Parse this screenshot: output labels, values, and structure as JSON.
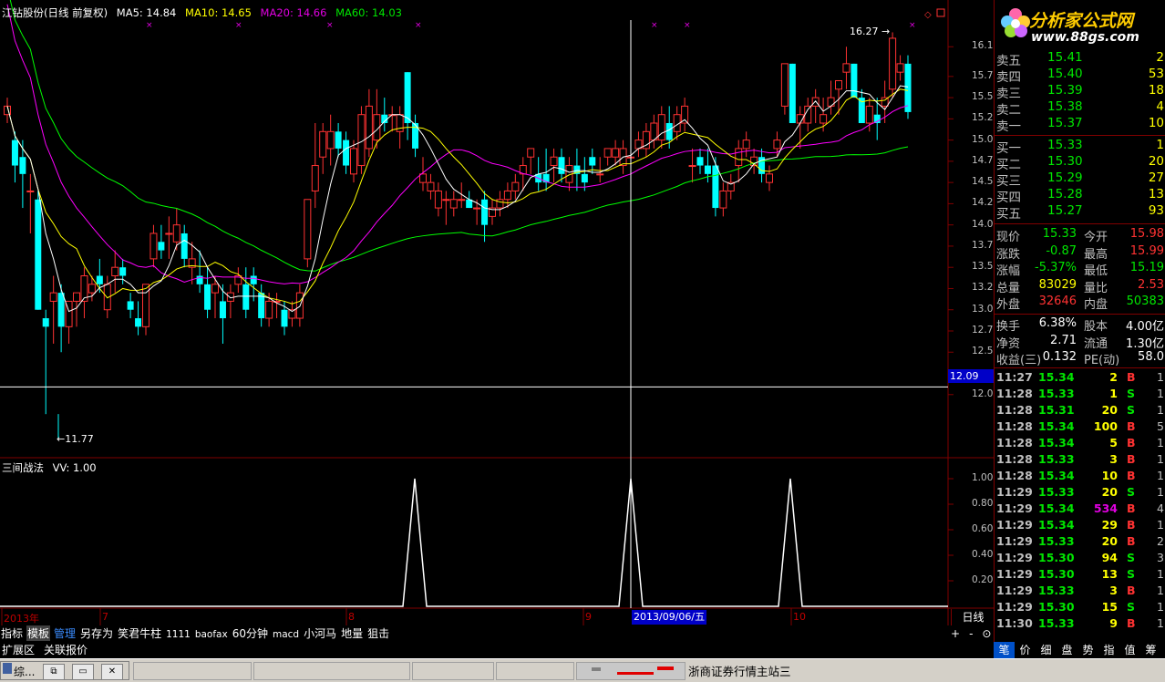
{
  "title": {
    "stock": "江钻股份(日线 前复权)",
    "ma5": "MA5: 14.84",
    "ma10": "MA10: 14.65",
    "ma20": "MA20: 14.66",
    "ma60": "MA60: 14.03"
  },
  "colors": {
    "ma5": "#ffffff",
    "ma10": "#ffff00",
    "ma20": "#ff00ff",
    "ma60": "#00ff00",
    "up": "#ff3232",
    "down": "#00ffff",
    "grid": "#800000"
  },
  "chart_data": {
    "type": "candlestick",
    "ylim": [
      11.6,
      16.35
    ],
    "yticks": [
      "16.1",
      "15.75",
      "15.50",
      "15.25",
      "15.00",
      "14.75",
      "14.50",
      "14.25",
      "14.00",
      "13.75",
      "13.50",
      "13.25",
      "13.00",
      "12.75",
      "12.50",
      "12.00"
    ],
    "high_annotation": "16.27",
    "low_annotation": "11.77",
    "crosshair_price": "12.09",
    "crosshair_date": "2013/09/06/五",
    "x_labels": [
      "2013年",
      "7",
      "8",
      "9",
      "10"
    ],
    "candles": [
      [
        15.3,
        15.5,
        15.2,
        15.4
      ],
      [
        15.0,
        15.1,
        14.5,
        14.7
      ],
      [
        14.8,
        15.0,
        14.2,
        14.6
      ],
      [
        14.4,
        14.6,
        13.9,
        14.4
      ],
      [
        14.3,
        14.4,
        13.0,
        13.0
      ],
      [
        12.9,
        13.0,
        11.77,
        12.8
      ],
      [
        13.1,
        13.4,
        12.6,
        13.2
      ],
      [
        13.2,
        13.3,
        12.5,
        12.8
      ],
      [
        12.8,
        13.1,
        12.6,
        13.1
      ],
      [
        13.1,
        13.2,
        12.8,
        13.2
      ],
      [
        13.1,
        13.5,
        12.9,
        13.4
      ],
      [
        13.2,
        13.4,
        13.1,
        13.3
      ],
      [
        13.4,
        13.6,
        13.2,
        13.3
      ],
      [
        13.0,
        13.4,
        12.9,
        13.3
      ],
      [
        13.4,
        13.7,
        13.2,
        13.5
      ],
      [
        13.5,
        13.6,
        13.3,
        13.4
      ],
      [
        13.1,
        13.2,
        12.9,
        13.0
      ],
      [
        12.9,
        13.1,
        12.7,
        12.8
      ],
      [
        12.8,
        13.3,
        12.7,
        13.3
      ],
      [
        13.6,
        14.0,
        13.5,
        13.9
      ],
      [
        13.8,
        14.0,
        13.6,
        13.7
      ],
      [
        13.9,
        14.1,
        13.6,
        13.9
      ],
      [
        13.8,
        14.2,
        13.7,
        14.0
      ],
      [
        13.9,
        14.0,
        13.5,
        13.6
      ],
      [
        13.5,
        13.8,
        13.3,
        13.6
      ],
      [
        13.4,
        13.7,
        13.2,
        13.3
      ],
      [
        13.3,
        13.5,
        12.9,
        13.0
      ],
      [
        13.2,
        13.4,
        12.9,
        13.3
      ],
      [
        13.1,
        13.3,
        12.6,
        12.9
      ],
      [
        13.1,
        13.3,
        12.9,
        13.2
      ],
      [
        13.3,
        13.5,
        13.2,
        13.4
      ],
      [
        13.3,
        13.5,
        12.9,
        13.0
      ],
      [
        13.4,
        13.5,
        13.1,
        13.3
      ],
      [
        13.2,
        13.3,
        12.8,
        12.9
      ],
      [
        12.9,
        13.2,
        12.8,
        13.1
      ],
      [
        13.1,
        13.2,
        12.9,
        13.1
      ],
      [
        13.0,
        13.1,
        12.7,
        12.8
      ],
      [
        12.9,
        13.1,
        12.8,
        13.0
      ],
      [
        12.9,
        13.3,
        12.8,
        13.2
      ],
      [
        13.6,
        14.3,
        13.5,
        14.3
      ],
      [
        14.4,
        15.2,
        14.2,
        14.7
      ],
      [
        14.8,
        15.2,
        14.6,
        15.1
      ],
      [
        14.9,
        15.3,
        14.7,
        15.1
      ],
      [
        15.1,
        15.2,
        14.8,
        14.9
      ],
      [
        15.0,
        15.1,
        14.6,
        14.7
      ],
      [
        14.6,
        15.0,
        14.5,
        14.9
      ],
      [
        14.7,
        15.4,
        14.6,
        15.3
      ],
      [
        14.9,
        15.6,
        14.8,
        15.4
      ],
      [
        15.0,
        15.6,
        14.9,
        15.3
      ],
      [
        15.3,
        15.5,
        15.1,
        15.2
      ],
      [
        15.3,
        15.4,
        15.1,
        15.3
      ],
      [
        15.1,
        15.4,
        14.9,
        15.3
      ],
      [
        15.8,
        15.8,
        15.0,
        15.2
      ],
      [
        15.2,
        15.3,
        14.8,
        14.9
      ],
      [
        14.5,
        14.8,
        14.4,
        14.6
      ],
      [
        14.4,
        14.6,
        14.3,
        14.5
      ],
      [
        14.2,
        14.5,
        14.1,
        14.4
      ],
      [
        14.3,
        14.4,
        14.0,
        14.3
      ],
      [
        14.2,
        14.4,
        14.1,
        14.3
      ],
      [
        14.3,
        14.5,
        14.2,
        14.3
      ],
      [
        14.3,
        14.4,
        14.2,
        14.2
      ],
      [
        14.2,
        14.3,
        14.0,
        14.2
      ],
      [
        14.3,
        14.4,
        13.8,
        14.0
      ],
      [
        14.1,
        14.3,
        14.0,
        14.2
      ],
      [
        14.2,
        14.4,
        14.1,
        14.3
      ],
      [
        14.3,
        14.5,
        14.2,
        14.4
      ],
      [
        14.4,
        14.6,
        14.3,
        14.5
      ],
      [
        14.6,
        14.8,
        14.4,
        14.7
      ],
      [
        14.8,
        14.9,
        14.6,
        14.9
      ],
      [
        14.6,
        14.8,
        14.4,
        14.5
      ],
      [
        14.6,
        14.9,
        14.4,
        14.5
      ],
      [
        14.7,
        14.9,
        14.5,
        14.8
      ],
      [
        14.8,
        14.9,
        14.5,
        14.6
      ],
      [
        14.5,
        14.8,
        14.4,
        14.7
      ],
      [
        14.7,
        14.9,
        14.4,
        14.6
      ],
      [
        14.6,
        14.8,
        14.4,
        14.5
      ],
      [
        14.8,
        14.9,
        14.6,
        14.7
      ],
      [
        14.6,
        14.8,
        14.5,
        14.6
      ],
      [
        14.8,
        14.9,
        14.7,
        14.9
      ],
      [
        14.8,
        15.0,
        14.7,
        14.9
      ],
      [
        14.7,
        15.0,
        14.6,
        14.9
      ],
      [
        14.8,
        15.0,
        14.7,
        14.8
      ],
      [
        14.9,
        15.1,
        14.8,
        15.0
      ],
      [
        14.9,
        15.2,
        14.8,
        15.1
      ],
      [
        15.0,
        15.3,
        14.9,
        15.2
      ],
      [
        15.0,
        15.4,
        14.9,
        15.3
      ],
      [
        15.2,
        15.4,
        14.9,
        15.0
      ],
      [
        15.1,
        15.4,
        15.0,
        15.3
      ],
      [
        15.2,
        15.5,
        15.1,
        15.4
      ],
      [
        14.7,
        14.9,
        14.5,
        14.7
      ],
      [
        14.8,
        14.9,
        14.6,
        14.7
      ],
      [
        14.7,
        14.9,
        14.5,
        14.6
      ],
      [
        14.7,
        14.8,
        14.1,
        14.2
      ],
      [
        14.2,
        14.5,
        14.1,
        14.4
      ],
      [
        14.4,
        14.6,
        14.3,
        14.5
      ],
      [
        14.7,
        15.0,
        14.5,
        14.9
      ],
      [
        14.9,
        15.1,
        14.8,
        15.0
      ],
      [
        14.7,
        14.9,
        14.6,
        14.8
      ],
      [
        14.8,
        14.9,
        14.5,
        14.6
      ],
      [
        14.5,
        14.7,
        14.4,
        14.6
      ],
      [
        14.9,
        15.1,
        14.8,
        15.0
      ],
      [
        15.4,
        15.9,
        15.3,
        15.9
      ],
      [
        15.9,
        15.9,
        15.2,
        15.2
      ],
      [
        15.2,
        15.4,
        14.9,
        15.3
      ],
      [
        15.2,
        15.5,
        15.1,
        15.4
      ],
      [
        15.4,
        15.6,
        15.2,
        15.5
      ],
      [
        15.2,
        15.5,
        15.1,
        15.3
      ],
      [
        15.4,
        15.7,
        15.3,
        15.5
      ],
      [
        15.6,
        15.7,
        15.3,
        15.7
      ],
      [
        15.8,
        16.1,
        15.6,
        15.9
      ],
      [
        15.9,
        15.9,
        15.5,
        15.5
      ],
      [
        15.5,
        15.6,
        15.2,
        15.2
      ],
      [
        15.2,
        15.5,
        15.1,
        15.4
      ],
      [
        15.3,
        15.5,
        15.0,
        15.2
      ],
      [
        15.4,
        15.7,
        15.2,
        15.5
      ],
      [
        15.6,
        16.27,
        15.5,
        16.2
      ],
      [
        15.8,
        16.0,
        15.7,
        15.9
      ],
      [
        15.9,
        16.0,
        15.25,
        15.33
      ]
    ]
  },
  "indicator": {
    "title": "三间战法",
    "value": "VV: 1.00",
    "yticks": [
      "1.00",
      "0.80",
      "0.60",
      "0.40",
      "0.20"
    ]
  },
  "toolbar": {
    "items": [
      "指标",
      "模板",
      "管理",
      "另存为",
      "笑君牛柱",
      "1111",
      "baofax",
      "60分钟",
      "macd",
      "小河马",
      "地量",
      "狙击"
    ],
    "row2": [
      "扩展区",
      "关联报价"
    ],
    "period": "日线",
    "zoom": [
      "+",
      "-",
      "⊙"
    ]
  },
  "panel": {
    "logo_name": "分析家公式网",
    "logo_url": "www.88gs.com",
    "sell": [
      {
        "label": "卖五",
        "price": "15.41",
        "vol": "2"
      },
      {
        "label": "卖四",
        "price": "15.40",
        "vol": "53"
      },
      {
        "label": "卖三",
        "price": "15.39",
        "vol": "18"
      },
      {
        "label": "卖二",
        "price": "15.38",
        "vol": "4"
      },
      {
        "label": "卖一",
        "price": "15.37",
        "vol": "10"
      }
    ],
    "buy": [
      {
        "label": "买一",
        "price": "15.33",
        "vol": "1"
      },
      {
        "label": "买二",
        "price": "15.30",
        "vol": "20"
      },
      {
        "label": "买三",
        "price": "15.29",
        "vol": "27"
      },
      {
        "label": "买四",
        "price": "15.28",
        "vol": "13"
      },
      {
        "label": "买五",
        "price": "15.27",
        "vol": "93"
      }
    ],
    "quote": [
      {
        "a": "现价",
        "b": "15.33",
        "bc": "green",
        "c": "今开",
        "d": "15.98",
        "dc": "red"
      },
      {
        "a": "涨跌",
        "b": "-0.87",
        "bc": "green",
        "c": "最高",
        "d": "15.99",
        "dc": "red"
      },
      {
        "a": "涨幅",
        "b": "-5.37%",
        "bc": "green",
        "c": "最低",
        "d": "15.19",
        "dc": "green"
      },
      {
        "a": "总量",
        "b": "83029",
        "bc": "yellow",
        "c": "量比",
        "d": "2.53",
        "dc": "red"
      },
      {
        "a": "外盘",
        "b": "32646",
        "bc": "red",
        "c": "内盘",
        "d": "50383",
        "dc": "green"
      }
    ],
    "quote2": [
      {
        "a": "换手",
        "b": "6.38%",
        "c": "股本",
        "d": "4.00亿"
      },
      {
        "a": "净资",
        "b": "2.71",
        "c": "流通",
        "d": "1.30亿"
      },
      {
        "a": "收益(三)",
        "b": "0.132",
        "c": "PE(动)",
        "d": "58.0"
      }
    ],
    "ticks": [
      {
        "t": "11:27",
        "p": "15.34",
        "pc": "green",
        "v": "2",
        "vc": "yellow",
        "s": "B",
        "sc": "red",
        "n": "1"
      },
      {
        "t": "11:28",
        "p": "15.33",
        "pc": "green",
        "v": "1",
        "vc": "yellow",
        "s": "S",
        "sc": "green",
        "n": "1"
      },
      {
        "t": "11:28",
        "p": "15.31",
        "pc": "green",
        "v": "20",
        "vc": "yellow",
        "s": "S",
        "sc": "green",
        "n": "1"
      },
      {
        "t": "11:28",
        "p": "15.34",
        "pc": "green",
        "v": "100",
        "vc": "yellow",
        "s": "B",
        "sc": "red",
        "n": "5"
      },
      {
        "t": "11:28",
        "p": "15.34",
        "pc": "green",
        "v": "5",
        "vc": "yellow",
        "s": "B",
        "sc": "red",
        "n": "1"
      },
      {
        "t": "11:28",
        "p": "15.33",
        "pc": "green",
        "v": "3",
        "vc": "yellow",
        "s": "B",
        "sc": "red",
        "n": "1"
      },
      {
        "t": "11:28",
        "p": "15.34",
        "pc": "green",
        "v": "10",
        "vc": "yellow",
        "s": "B",
        "sc": "red",
        "n": "1"
      },
      {
        "t": "11:29",
        "p": "15.33",
        "pc": "green",
        "v": "20",
        "vc": "yellow",
        "s": "S",
        "sc": "green",
        "n": "1"
      },
      {
        "t": "11:29",
        "p": "15.34",
        "pc": "green",
        "v": "534",
        "vc": "mag",
        "s": "B",
        "sc": "red",
        "n": "4"
      },
      {
        "t": "11:29",
        "p": "15.34",
        "pc": "green",
        "v": "29",
        "vc": "yellow",
        "s": "B",
        "sc": "red",
        "n": "1"
      },
      {
        "t": "11:29",
        "p": "15.33",
        "pc": "green",
        "v": "20",
        "vc": "yellow",
        "s": "B",
        "sc": "red",
        "n": "2"
      },
      {
        "t": "11:29",
        "p": "15.30",
        "pc": "green",
        "v": "94",
        "vc": "yellow",
        "s": "S",
        "sc": "green",
        "n": "3"
      },
      {
        "t": "11:29",
        "p": "15.30",
        "pc": "green",
        "v": "13",
        "vc": "yellow",
        "s": "S",
        "sc": "green",
        "n": "1"
      },
      {
        "t": "11:29",
        "p": "15.33",
        "pc": "green",
        "v": "3",
        "vc": "yellow",
        "s": "B",
        "sc": "red",
        "n": "1"
      },
      {
        "t": "11:29",
        "p": "15.30",
        "pc": "green",
        "v": "15",
        "vc": "yellow",
        "s": "S",
        "sc": "green",
        "n": "1"
      },
      {
        "t": "11:30",
        "p": "15.33",
        "pc": "green",
        "v": "9",
        "vc": "yellow",
        "s": "B",
        "sc": "red",
        "n": "1"
      }
    ],
    "tabs": [
      "笔",
      "价",
      "细",
      "盘",
      "势",
      "指",
      "值",
      "筹"
    ]
  },
  "taskbar": {
    "left": "综...",
    "status": "浙商证券行情主站三"
  }
}
